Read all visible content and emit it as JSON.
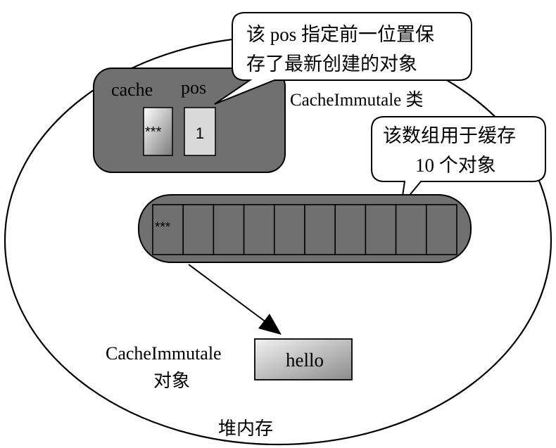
{
  "heap_label": "堆内存",
  "class_label": "CacheImmutale 类",
  "fields": {
    "cache_label": "cache",
    "pos_label": "pos",
    "cache_value": "***",
    "pos_value": "1"
  },
  "callouts": {
    "pos_note_line1": "该 pos 指定前一位置保",
    "pos_note_line2": "存了最新创建的对象",
    "array_note_line1": "该数组用于缓存",
    "array_note_line2": "10 个对象"
  },
  "array": {
    "first_cell": "***",
    "cell_count": 10
  },
  "object": {
    "label_line1": "CacheImmutale",
    "label_line2": "对象",
    "value": "hello"
  }
}
